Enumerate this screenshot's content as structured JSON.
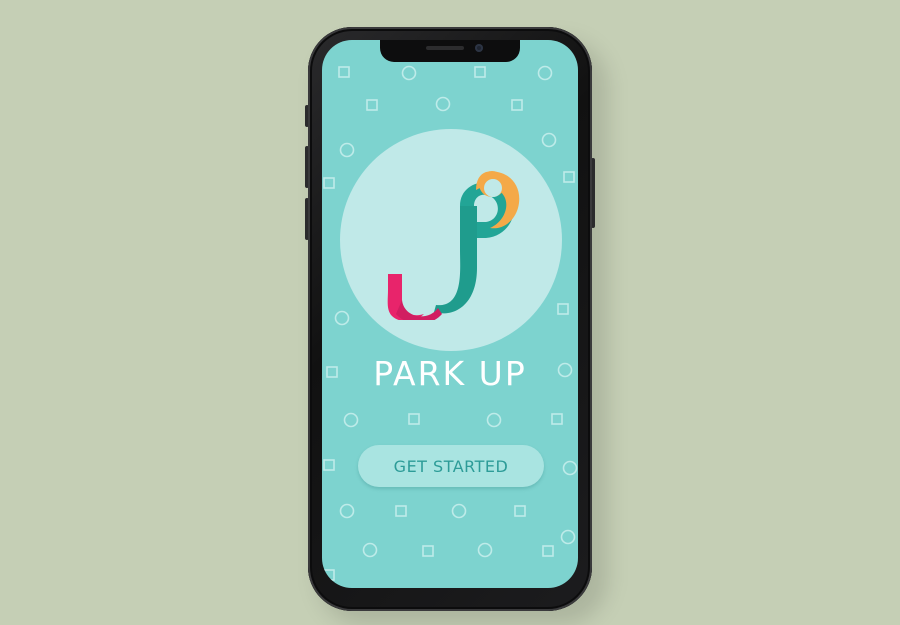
{
  "app": {
    "title": "PARK UP",
    "logo_name": "park-up-logo"
  },
  "actions": {
    "get_started_label": "GET STARTED"
  },
  "colors": {
    "background": "#c5cfb5",
    "screen": "#7dd3cf",
    "logo_circle": "#c0e9e8",
    "logo_teal": "#22a596",
    "logo_pink": "#e8246b",
    "logo_orange": "#f4a948",
    "button": "#a9e4e1",
    "button_text": "#2d9c98"
  }
}
